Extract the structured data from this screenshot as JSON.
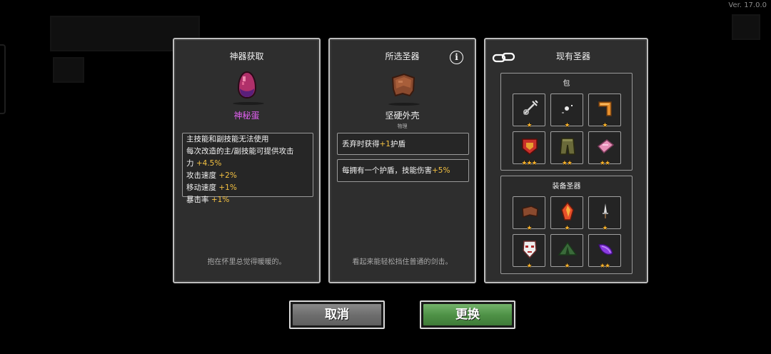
{
  "version": "Ver. 17.0.0",
  "panels": {
    "left": {
      "title": "神器获取",
      "item_name": "神秘蛋",
      "item_name_color": "#e060f0",
      "desc_lines": [
        {
          "text": "主技能和副技能无法使用",
          "hl": ""
        },
        {
          "text": "每次改造的主/副技能可提供攻击",
          "hl": ""
        },
        {
          "text": "力 ",
          "hl": "+4.5%"
        },
        {
          "text": "攻击速度 ",
          "hl": "+2%"
        },
        {
          "text": "移动速度 ",
          "hl": "+1%"
        },
        {
          "text": "暴击率 ",
          "hl": "+1%"
        }
      ],
      "flavor": "抱在怀里总觉得暖暖的。"
    },
    "middle": {
      "title": "所选圣器",
      "info_icon": "info-icon",
      "item_name": "坚硬外壳",
      "item_type": "物理",
      "effects": [
        {
          "pre": "丢弃时获得",
          "hl": "+1",
          "post": "护盾"
        },
        {
          "pre": "每拥有一个护盾，技能伤害",
          "hl": "+5%",
          "post": ""
        }
      ],
      "flavor": "看起来能轻松挡住普通的剑击。"
    },
    "right": {
      "title": "现有圣器",
      "link_icon": "link-icon",
      "bag": {
        "title": "包",
        "slots": [
          {
            "icon": "trident-icon",
            "stars": "★"
          },
          {
            "icon": "whip-icon",
            "stars": "★"
          },
          {
            "icon": "boomerang-icon",
            "stars": "★"
          },
          {
            "icon": "shield-crest-icon",
            "stars": "★★★"
          },
          {
            "icon": "pants-icon",
            "stars": "★★"
          },
          {
            "icon": "pink-scroll-icon",
            "stars": "★★"
          }
        ]
      },
      "equipped": {
        "title": "装备圣器",
        "slots": [
          {
            "icon": "leather-shell-icon",
            "stars": "★"
          },
          {
            "icon": "fire-crystal-icon",
            "stars": "★"
          },
          {
            "icon": "dagger-icon",
            "stars": "★"
          },
          {
            "icon": "mask-icon",
            "stars": "★"
          },
          {
            "icon": "tent-icon",
            "stars": "★"
          },
          {
            "icon": "purple-feather-icon",
            "stars": "★★"
          }
        ]
      }
    }
  },
  "buttons": {
    "cancel": "取消",
    "confirm": "更换"
  },
  "colors": {
    "highlight": "#f5c242",
    "star": "#f5b02c",
    "confirm": "#4f9247",
    "cancel": "#6e6e6e"
  }
}
